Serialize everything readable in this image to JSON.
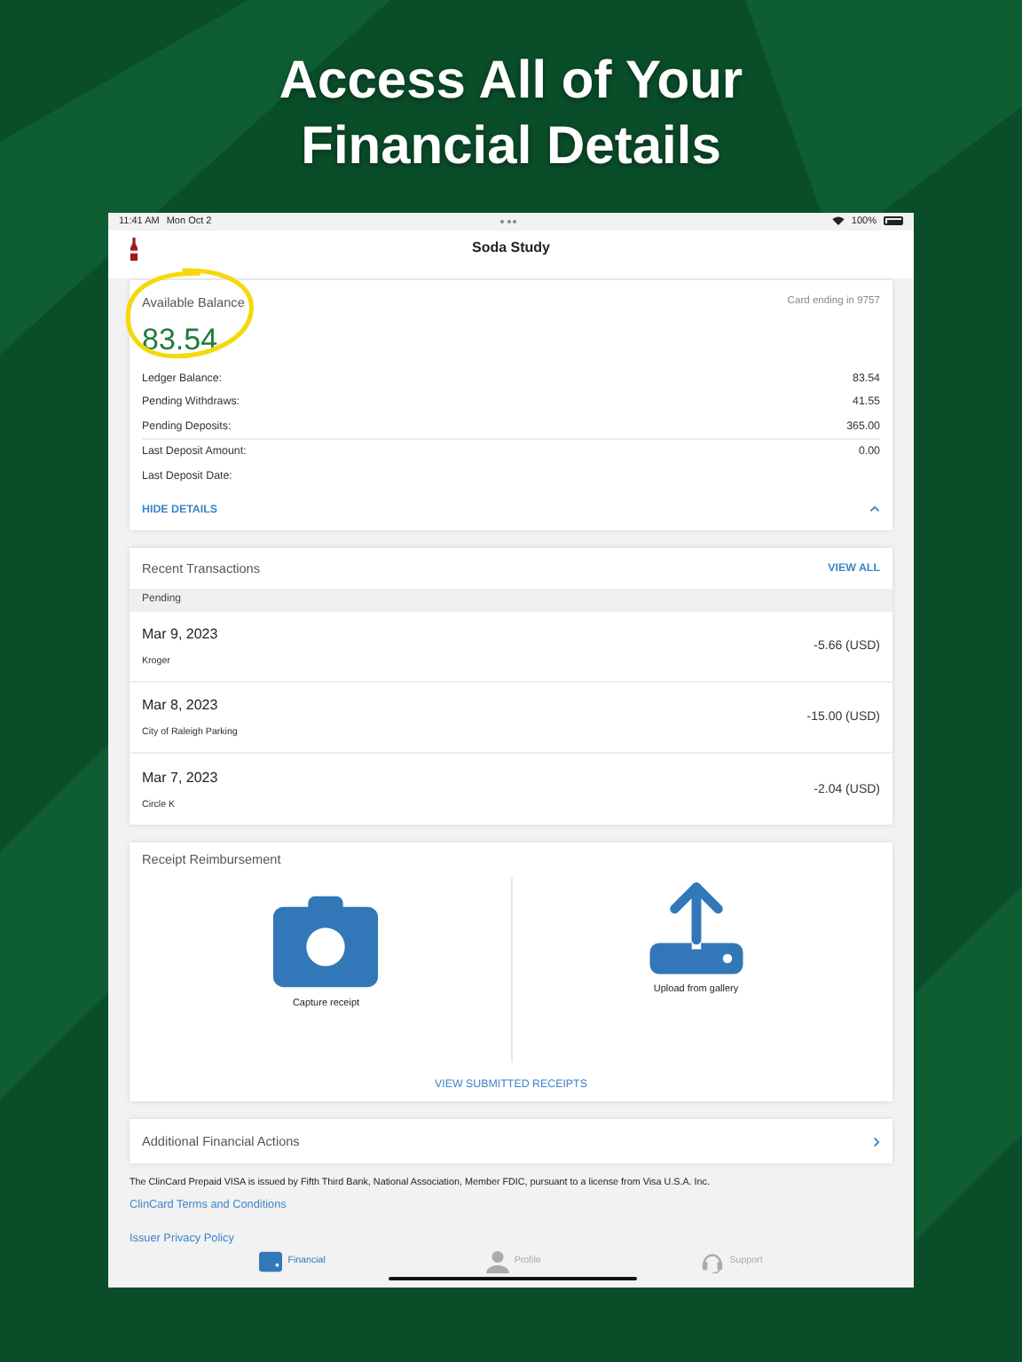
{
  "headline": [
    "Access All of Your",
    "Financial Details"
  ],
  "status_bar": {
    "time": "11:41 AM",
    "date": "Mon Oct 2",
    "battery": "100%"
  },
  "app_header": {
    "title": "Soda Study"
  },
  "balance_card": {
    "label": "Available Balance",
    "amount": "83.54",
    "card_info": "Card ending in 9757",
    "highlighted": true,
    "expanded": true,
    "details": [
      {
        "label": "Ledger Balance:",
        "value": "83.54"
      },
      {
        "label": "Pending Withdraws:",
        "value": "41.55"
      },
      {
        "label": "Pending Deposits:",
        "value": "365.00"
      },
      {
        "label": "Last Deposit Amount:",
        "value": "0.00"
      },
      {
        "label": "Last Deposit Date:"
      }
    ],
    "toggle": "HIDE DETAILS"
  },
  "transactions": {
    "title": "Recent Transactions",
    "view_all": "VIEW ALL",
    "section": "Pending",
    "items": [
      {
        "date": "Mar 9, 2023",
        "merchant": "Kroger",
        "amount": "-5.66 (USD)"
      },
      {
        "date": "Mar 8, 2023",
        "merchant": "City of Raleigh Parking",
        "amount": "-15.00 (USD)"
      },
      {
        "date": "Mar 7, 2023",
        "merchant": "Circle K",
        "amount": "-2.04 (USD)"
      }
    ]
  },
  "receipts": {
    "title": "Receipt Reimbursement",
    "actions": [
      {
        "kind": "camera",
        "label": "Capture receipt"
      },
      {
        "kind": "upload",
        "label": "Upload from gallery"
      }
    ],
    "link": "VIEW SUBMITTED RECEIPTS"
  },
  "additional": {
    "label": "Additional Financial Actions"
  },
  "disclaimer": "The ClinCard Prepaid VISA is issued by Fifth Third Bank, National Association, Member FDIC, pursuant to a license from Visa U.S.A. Inc.",
  "links": [
    "ClinCard Terms and Conditions",
    "Issuer Privacy Policy"
  ],
  "tab_bar": [
    {
      "kind": "wallet",
      "label": "Financial",
      "selected": true
    },
    {
      "kind": "person",
      "label": "Profile",
      "selected": false
    },
    {
      "kind": "headset",
      "label": "Support",
      "selected": false
    }
  ]
}
